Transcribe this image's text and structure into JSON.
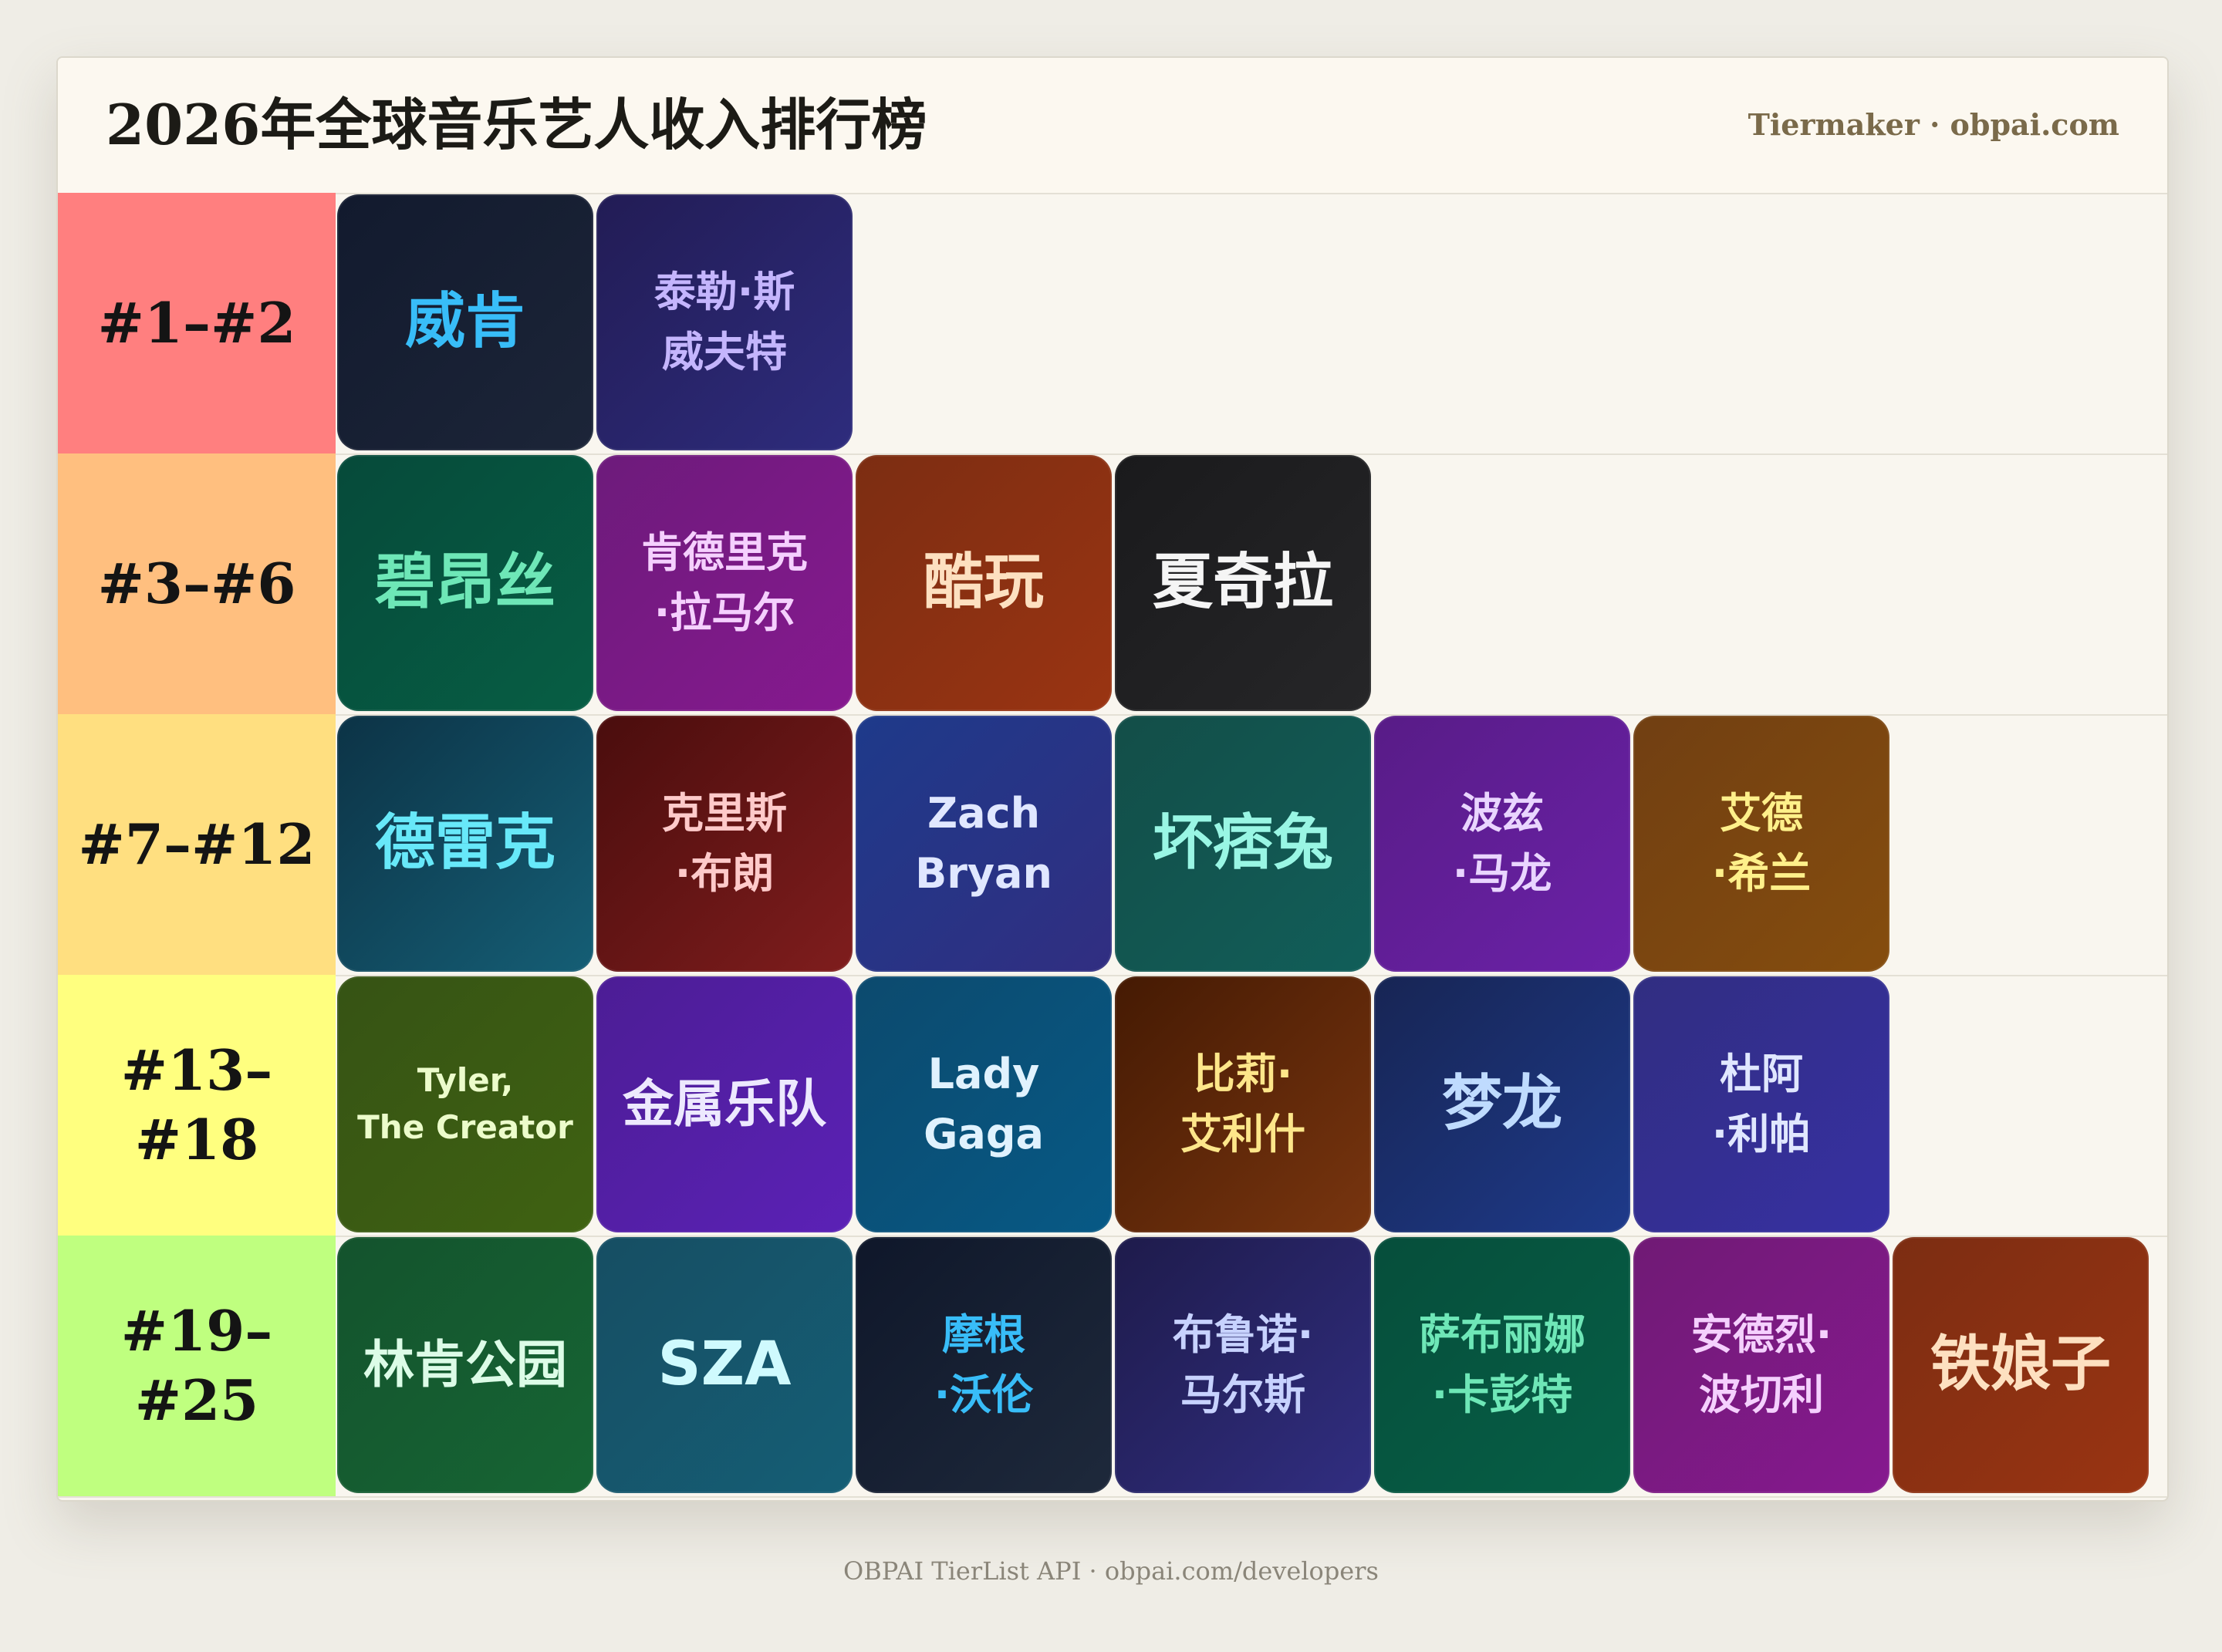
{
  "title": "2026年全球音乐艺人收入排行榜",
  "brand": "Tiermaker · obpai.com",
  "footer": "OBPAI TierList API · obpai.com/developers",
  "tiers": [
    {
      "label": "#1–#2",
      "color": "#ff7f7f",
      "items": [
        {
          "name": "威肯",
          "bg": [
            "#121a2e",
            "#1c2538"
          ],
          "fg": "#38bdf8",
          "size": 78
        },
        {
          "name": "泰勒·斯\n威夫特",
          "bg": [
            "#221c55",
            "#2e2c7d"
          ],
          "fg": "#c4b5fd",
          "size": 54
        }
      ]
    },
    {
      "label": "#3–#6",
      "color": "#ffbf7f",
      "items": [
        {
          "name": "碧昂丝",
          "bg": [
            "#064a3a",
            "#075e44"
          ],
          "fg": "#6ee7b7",
          "size": 78
        },
        {
          "name": "肯德里克\n·拉马尔",
          "bg": [
            "#6d1b7b",
            "#86198f"
          ],
          "fg": "#f5d0fe",
          "size": 54
        },
        {
          "name": "酷玩",
          "bg": [
            "#7c2d12",
            "#9a3412"
          ],
          "fg": "#fde0c0",
          "size": 78
        },
        {
          "name": "夏奇拉",
          "bg": [
            "#1a1a1c",
            "#262628"
          ],
          "fg": "#f5f5f5",
          "size": 78
        }
      ]
    },
    {
      "label": "#7–#12",
      "color": "#ffdf80",
      "items": [
        {
          "name": "德雷克",
          "bg": [
            "#0c3346",
            "#155e75"
          ],
          "fg": "#67e8f9",
          "size": 78
        },
        {
          "name": "克里斯\n·布朗",
          "bg": [
            "#4a0d0d",
            "#7f1d1d"
          ],
          "fg": "#fecaca",
          "size": 54
        },
        {
          "name": "Zach\nBryan",
          "bg": [
            "#1e3a8a",
            "#312e81"
          ],
          "fg": "#e0e7ff",
          "size": 54
        },
        {
          "name": "坏痞兔",
          "bg": [
            "#134e48",
            "#115e59"
          ],
          "fg": "#99f6e4",
          "size": 78
        },
        {
          "name": "波兹\n·马龙",
          "bg": [
            "#581c87",
            "#6b21a8"
          ],
          "fg": "#e9d5ff",
          "size": 54
        },
        {
          "name": "艾德\n·希兰",
          "bg": [
            "#713f12",
            "#854d0e"
          ],
          "fg": "#fef08a",
          "size": 54
        }
      ]
    },
    {
      "label": "#13–\n#18",
      "color": "#ffff7f",
      "items": [
        {
          "name": "Tyler,\nThe Creator",
          "bg": [
            "#365314",
            "#3f6212"
          ],
          "fg": "#ecfccb",
          "size": 42
        },
        {
          "name": "金属乐队",
          "bg": [
            "#4c1d95",
            "#5b21b6"
          ],
          "fg": "#ede9fe",
          "size": 66
        },
        {
          "name": "Lady\nGaga",
          "bg": [
            "#0c4a6e",
            "#075985"
          ],
          "fg": "#e0f2fe",
          "size": 54
        },
        {
          "name": "比莉·\n艾利什",
          "bg": [
            "#451a03",
            "#78350f"
          ],
          "fg": "#fde68a",
          "size": 54
        },
        {
          "name": "梦龙",
          "bg": [
            "#172554",
            "#1e3a8a"
          ],
          "fg": "#bfdbfe",
          "size": 78
        },
        {
          "name": "杜阿\n·利帕",
          "bg": [
            "#312e81",
            "#3730a3"
          ],
          "fg": "#e0e7ff",
          "size": 54
        }
      ]
    },
    {
      "label": "#19–\n#25",
      "color": "#bfff7f",
      "items": [
        {
          "name": "林肯公园",
          "bg": [
            "#14532d",
            "#166534"
          ],
          "fg": "#dcfce7",
          "size": 66
        },
        {
          "name": "SZA",
          "bg": [
            "#164e63",
            "#155e75"
          ],
          "fg": "#cffafe",
          "size": 78
        },
        {
          "name": "摩根\n·沃伦",
          "bg": [
            "#0f172a",
            "#1e293b"
          ],
          "fg": "#38bdf8",
          "size": 54
        },
        {
          "name": "布鲁诺·\n马尔斯",
          "bg": [
            "#1e1b4b",
            "#312e81"
          ],
          "fg": "#c7d2fe",
          "size": 54
        },
        {
          "name": "萨布丽娜\n·卡彭特",
          "bg": [
            "#064e3b",
            "#065f46"
          ],
          "fg": "#6ee7b7",
          "size": 54
        },
        {
          "name": "安德烈·\n波切利",
          "bg": [
            "#701a75",
            "#86198f"
          ],
          "fg": "#f5d0fe",
          "size": 54
        },
        {
          "name": "铁娘子",
          "bg": [
            "#7c2d12",
            "#9a3412"
          ],
          "fg": "#fde0c0",
          "size": 78
        }
      ]
    }
  ]
}
